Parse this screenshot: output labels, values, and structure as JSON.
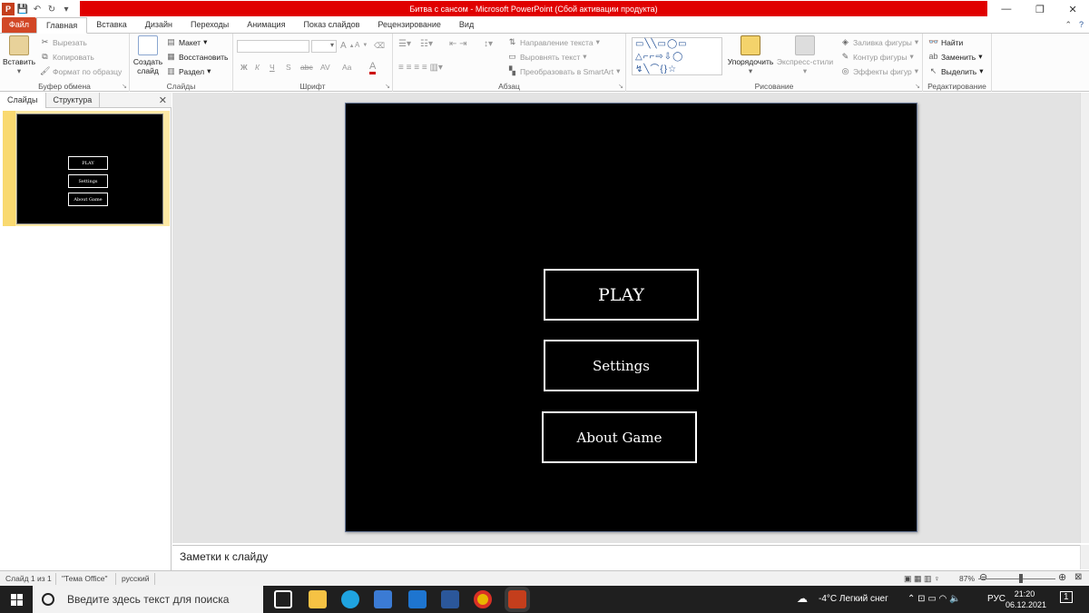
{
  "window": {
    "title": "Битва с сансом  -  Microsoft PowerPoint (Сбой активации продукта)",
    "controls": [
      "—",
      "❐",
      "✕"
    ]
  },
  "colors": {
    "accent_file_tab": "#d24726",
    "title_bar_red": "#e00000",
    "slide_bg": "#000000"
  },
  "ribbon": {
    "tabs": [
      "Файл",
      "Главная",
      "Вставка",
      "Дизайн",
      "Переходы",
      "Анимация",
      "Показ слайдов",
      "Рецензирование",
      "Вид"
    ],
    "active_tab": "Главная",
    "clipboard": {
      "paste": "Вставить",
      "cut": "Вырезать",
      "copy": "Копировать",
      "format_painter": "Формат по образцу",
      "label": "Буфер обмена"
    },
    "slides": {
      "new_slide_line1": "Создать",
      "new_slide_line2": "слайд",
      "layout": "Макет",
      "reset": "Восстановить",
      "section": "Раздел",
      "label": "Слайды"
    },
    "font": {
      "label": "Шрифт",
      "bold": "Ж",
      "italic": "К",
      "underline": "Ч",
      "strike": "S",
      "shadow": "abc",
      "spacing": "AV",
      "case": "Aa",
      "color": "A",
      "grow": "A",
      "shrink": "A"
    },
    "paragraph": {
      "label": "Абзац",
      "text_direction": "Направление текста",
      "align_text": "Выровнять текст",
      "smartart": "Преобразовать в SmartArt"
    },
    "drawing": {
      "label": "Рисование",
      "arrange": "Упорядочить",
      "quick_styles": "Экспресс-стили",
      "fill": "Заливка фигуры",
      "outline": "Контур фигуры",
      "effects": "Эффекты фигур"
    },
    "editing": {
      "label": "Редактирование",
      "find": "Найти",
      "replace": "Заменить",
      "select": "Выделить"
    }
  },
  "left_pane": {
    "tabs": [
      "Слайды",
      "Структура"
    ],
    "active_tab": "Слайды",
    "slide_number": "1",
    "thumb_buttons": [
      "PLAY",
      "Settings",
      "About Game"
    ]
  },
  "slide": {
    "buttons": [
      "PLAY",
      "Settings",
      "About Game"
    ]
  },
  "notes": {
    "placeholder": "Заметки к слайду"
  },
  "status": {
    "slide": "Слайд 1 из 1",
    "theme": "\"Тема Office\"",
    "language": "русский",
    "zoom": "87%",
    "zoom_value": 0.87
  },
  "taskbar": {
    "search_placeholder": "Введите здесь текст для поиска",
    "weather": "-4°C  Легкий снег",
    "lang": "РУС",
    "time": "21:20",
    "date": "06.12.2021",
    "notifications": "1"
  }
}
